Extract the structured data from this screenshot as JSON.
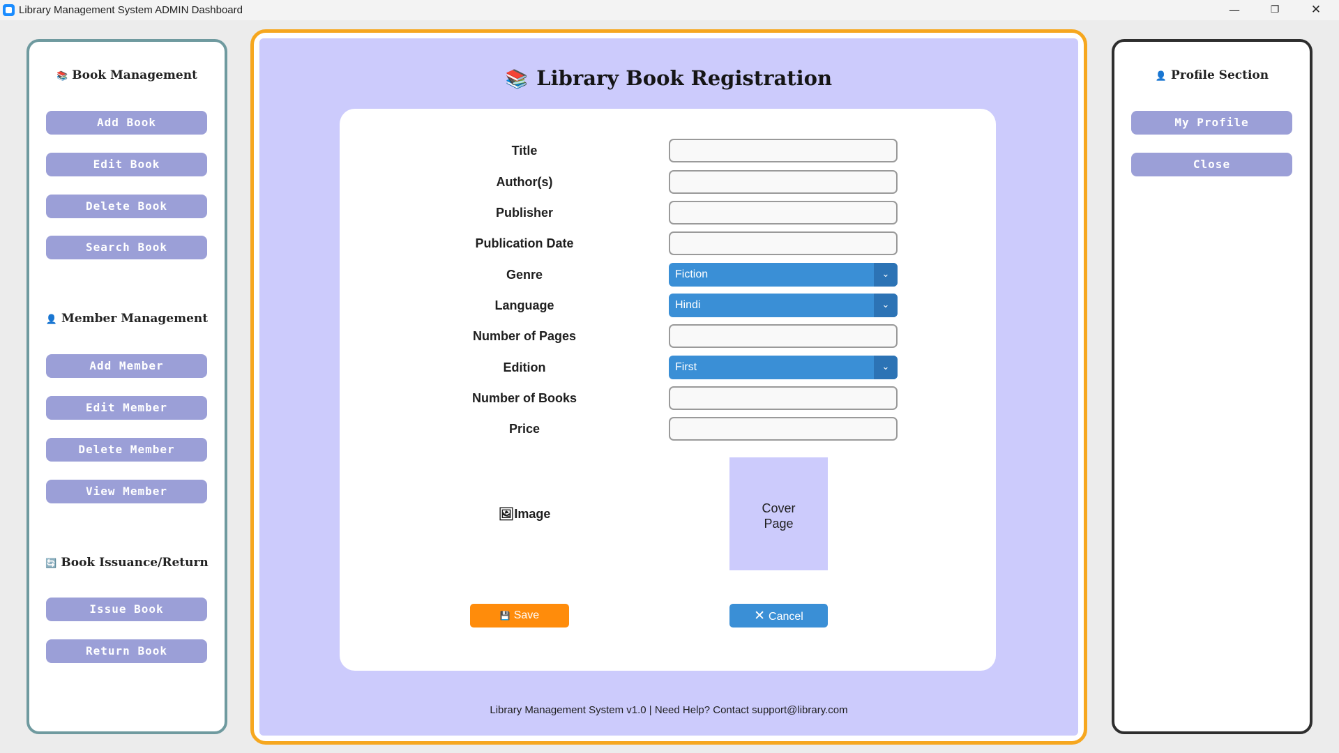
{
  "window": {
    "title": "Library Management System ADMIN Dashboard",
    "controls": {
      "minimize": "—",
      "maximize": "❐",
      "close": "✕"
    }
  },
  "sidebar_left": {
    "book_management": {
      "icon": "📚",
      "title": "Book Management",
      "buttons": [
        "Add Book",
        "Edit Book",
        "Delete Book",
        "Search Book"
      ]
    },
    "member_management": {
      "icon": "👤",
      "title": "Member Management",
      "buttons": [
        "Add Member",
        "Edit Member",
        "Delete Member",
        "View Member"
      ]
    },
    "book_issuance": {
      "icon": "🔄",
      "title": "Book Issuance/Return",
      "buttons": [
        "Issue Book",
        "Return Book"
      ]
    }
  },
  "sidebar_right": {
    "profile": {
      "icon": "👤",
      "title": "Profile Section",
      "buttons": [
        "My Profile",
        "Close"
      ]
    }
  },
  "main": {
    "title_icon": "📚",
    "title": "Library Book Registration",
    "form": {
      "title_label": "Title",
      "title_value": "",
      "authors_label": "Author(s)",
      "authors_value": "",
      "publisher_label": "Publisher",
      "publisher_value": "",
      "publication_date_label": "Publication Date",
      "publication_date_value": "",
      "genre_label": "Genre",
      "genre_value": "Fiction",
      "language_label": "Language",
      "language_value": "Hindi",
      "pages_label": "Number of Pages",
      "pages_value": "",
      "edition_label": "Edition",
      "edition_value": "First",
      "books_count_label": "Number of Books",
      "books_count_value": "",
      "price_label": "Price",
      "price_value": "",
      "image_icon": "🖼",
      "image_label": "Image",
      "cover_line1": "Cover",
      "cover_line2": "Page",
      "dropdown_arrow": "⌄"
    },
    "save_icon": "💾",
    "save_label": "Save",
    "cancel_icon": "✕",
    "cancel_label": "Cancel",
    "footer": "Library Management System v1.0 | Need Help? Contact support@library.com"
  },
  "colors": {
    "accent_orange": "#ff8c0b",
    "accent_blue": "#3a8fd6",
    "lavender": "#cccbfc",
    "side_button": "#9b9fd7"
  }
}
